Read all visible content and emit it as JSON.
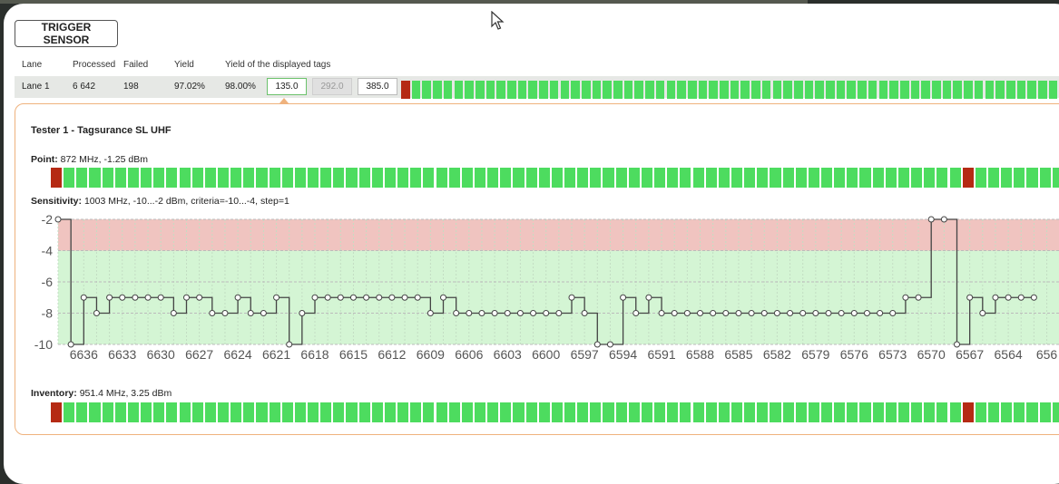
{
  "trigger_button": "TRIGGER SENSOR",
  "table": {
    "headers": [
      "Lane",
      "Processed",
      "Failed",
      "Yield",
      "Yield of the displayed tags"
    ],
    "row": {
      "lane": "Lane 1",
      "processed": "6 642",
      "failed": "198",
      "yield": "97.02%",
      "yield_displayed": "98.00%",
      "box1": "135.0",
      "box2": "292.0",
      "box3": "385.0"
    }
  },
  "tester_title": "Tester 1 - Tagsurance SL UHF",
  "point": {
    "label": "Point:",
    "value": "872 MHz, -1.25 dBm"
  },
  "sensitivity": {
    "label": "Sensitivity:",
    "value": "1003 MHz, -10...-2 dBm, criteria=-10...-4, step=1"
  },
  "inventory": {
    "label": "Inventory:",
    "value": "951.4 MHz, 3.25 dBm"
  },
  "colors": {
    "pass": "#4ddc5f",
    "fail": "#b52a14",
    "fail_band": "#f0c4c0",
    "pass_band": "#d4f5d4",
    "accent": "#efb27d"
  },
  "strips": {
    "lane_count": 62,
    "lane_fail": [
      0
    ],
    "point_count": 80,
    "point_fail": [
      0,
      71
    ],
    "inventory_count": 80,
    "inventory_fail": [
      0,
      71
    ]
  },
  "chart_data": {
    "type": "line",
    "title": "",
    "xlabel": "",
    "ylabel": "",
    "ylim": [
      -10,
      -2
    ],
    "yticks": [
      -2,
      -4,
      -6,
      -8,
      -10
    ],
    "xticks": [
      "6636",
      "6633",
      "6630",
      "6627",
      "6624",
      "6621",
      "6618",
      "6615",
      "6612",
      "6609",
      "6606",
      "6603",
      "6600",
      "6597",
      "6594",
      "6591",
      "6588",
      "6585",
      "6582",
      "6579",
      "6576",
      "6573",
      "6570",
      "6567",
      "6564",
      "656"
    ],
    "bands": [
      {
        "from": -4,
        "to": -2,
        "status": "fail"
      },
      {
        "from": -10,
        "to": -4,
        "status": "pass"
      }
    ],
    "x": [
      6638,
      6637,
      6636,
      6635,
      6634,
      6633,
      6632,
      6631,
      6630,
      6629,
      6628,
      6627,
      6626,
      6625,
      6624,
      6623,
      6622,
      6621,
      6620,
      6619,
      6618,
      6617,
      6616,
      6615,
      6614,
      6613,
      6612,
      6611,
      6610,
      6609,
      6608,
      6607,
      6606,
      6605,
      6604,
      6603,
      6602,
      6601,
      6600,
      6599,
      6598,
      6597,
      6596,
      6595,
      6594,
      6593,
      6592,
      6591,
      6590,
      6589,
      6588,
      6587,
      6586,
      6585,
      6584,
      6583,
      6582,
      6581,
      6580,
      6579,
      6578,
      6577,
      6576,
      6575,
      6574,
      6573,
      6572,
      6571,
      6570,
      6569,
      6568,
      6567,
      6566,
      6565,
      6564,
      6563,
      6562
    ],
    "values": [
      -2,
      -10,
      -7,
      -8,
      -7,
      -7,
      -7,
      -7,
      -7,
      -8,
      -7,
      -7,
      -8,
      -8,
      -7,
      -8,
      -8,
      -7,
      -10,
      -8,
      -7,
      -7,
      -7,
      -7,
      -7,
      -7,
      -7,
      -7,
      -7,
      -8,
      -7,
      -8,
      -8,
      -8,
      -8,
      -8,
      -8,
      -8,
      -8,
      -8,
      -7,
      -8,
      -10,
      -10,
      -7,
      -8,
      -7,
      -8,
      -8,
      -8,
      -8,
      -8,
      -8,
      -8,
      -8,
      -8,
      -8,
      -8,
      -8,
      -8,
      -8,
      -8,
      -8,
      -8,
      -8,
      -8,
      -7,
      -7,
      -2,
      -2,
      -10,
      -7,
      -8,
      -7,
      -7,
      -7,
      -7
    ]
  }
}
